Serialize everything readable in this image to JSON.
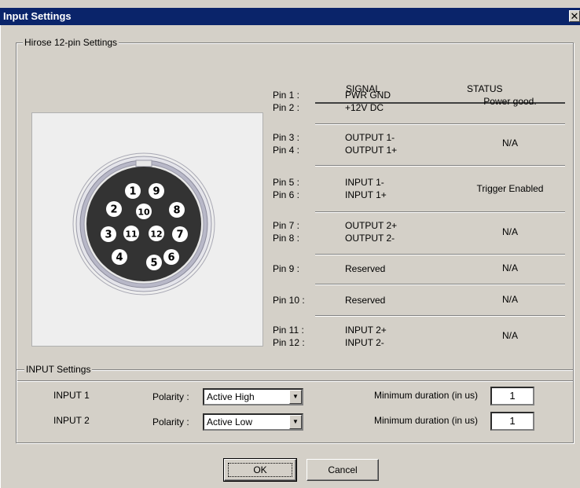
{
  "window": {
    "title": "Input Settings",
    "close_glyph": "✕"
  },
  "hirose": {
    "group_title": "Hirose 12-pin Settings",
    "header_signal": "SIGNAL",
    "header_status": "STATUS",
    "connector_pins": [
      "1",
      "2",
      "3",
      "4",
      "5",
      "6",
      "7",
      "8",
      "9",
      "10",
      "11",
      "12"
    ],
    "rows": [
      {
        "pins_a": "Pin 1 :",
        "pins_b": "Pin 2 :",
        "sig_a": "PWR GND",
        "sig_b": "+12V DC",
        "status": "Power good."
      },
      {
        "pins_a": "Pin 3 :",
        "pins_b": "Pin 4 :",
        "sig_a": "OUTPUT 1-",
        "sig_b": "OUTPUT 1+",
        "status": "N/A"
      },
      {
        "pins_a": "Pin 5 :",
        "pins_b": "Pin 6 :",
        "sig_a": "INPUT 1-",
        "sig_b": "INPUT 1+",
        "status": "Trigger Enabled"
      },
      {
        "pins_a": "Pin 7 :",
        "pins_b": "Pin 8 :",
        "sig_a": "OUTPUT 2+",
        "sig_b": "OUTPUT 2-",
        "status": "N/A"
      },
      {
        "pins_a": "Pin 9 :",
        "sig_a": "Reserved",
        "status": "N/A"
      },
      {
        "pins_a": "Pin 10 :",
        "sig_a": "Reserved",
        "status": "N/A"
      },
      {
        "pins_a": "Pin 11 :",
        "pins_b": "Pin 12 :",
        "sig_a": "INPUT 2+",
        "sig_b": "INPUT 2-",
        "status": "N/A"
      }
    ]
  },
  "input": {
    "group_title": "INPUT Settings",
    "polarity_label": "Polarity :",
    "min_duration_label": "Minimum duration  (in us)",
    "input1": {
      "name": "INPUT 1",
      "polarity": "Active High",
      "min_duration": "1"
    },
    "input2": {
      "name": "INPUT 2",
      "polarity": "Active Low",
      "min_duration": "1"
    }
  },
  "buttons": {
    "ok": "OK",
    "cancel": "Cancel"
  },
  "icons": {
    "dropdown": "chevron-down-icon",
    "close": "close-icon"
  },
  "colors": {
    "titlebar": "#0a246a",
    "face": "#d4d0c8",
    "connector_body": "#333333",
    "connector_ring": "#b8b8c8"
  }
}
